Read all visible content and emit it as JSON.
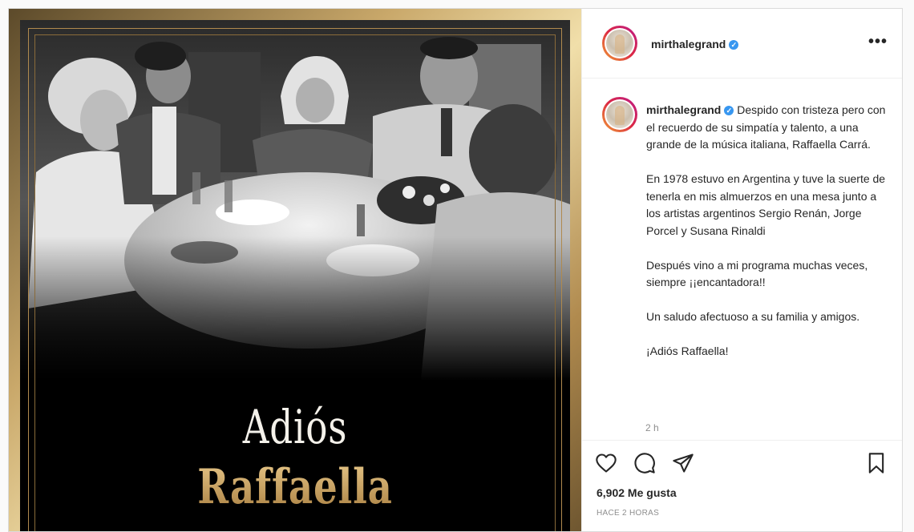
{
  "post": {
    "image": {
      "title_line1": "Adiós",
      "title_line2": "Raffaella",
      "accent_gold": "#c8a060",
      "photo_style": "black-and-white"
    },
    "header": {
      "username": "mirthalegrand",
      "verified_icon": "verified-badge-icon",
      "more_icon": "more-options-icon",
      "more_label": "•••"
    },
    "caption": {
      "username": "mirthalegrand",
      "paragraphs": [
        "Despido con tristeza pero con el recuerdo de su simpatía y talento, a una grande de la música italiana, Raffaella Carrá.",
        "En 1978 estuvo en Argentina y tuve la suerte de tenerla en mis almuerzos en una mesa junto a los artistas argentinos Sergio Renán, Jorge Porcel y Susana Rinaldi",
        "Después vino a mi programa muchas veces, siempre ¡¡encantadora!!",
        "Un saludo afectuoso a su familia y amigos.",
        "¡Adiós Raffaella!"
      ],
      "time": "2 h"
    },
    "actions": {
      "icons": [
        "heart-icon",
        "comment-icon",
        "share-icon",
        "bookmark-icon"
      ],
      "likes": "6,902 Me gusta",
      "posted": "HACE 2 HORAS"
    },
    "colors": {
      "verified": "#3897f0",
      "text": "#262626",
      "muted": "#8e8e8e"
    }
  }
}
